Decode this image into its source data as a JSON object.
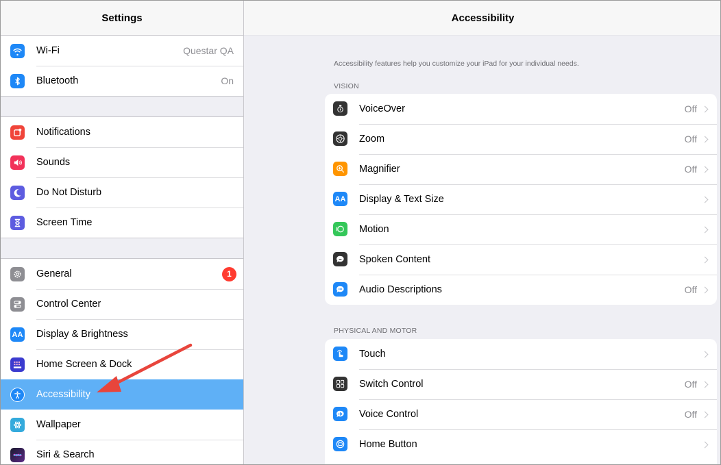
{
  "sidebar": {
    "title": "Settings",
    "groups": [
      [
        {
          "label": "Wi-Fi",
          "value": "Questar QA",
          "icon": "wifi-icon"
        },
        {
          "label": "Bluetooth",
          "value": "On",
          "icon": "bluetooth-icon"
        }
      ],
      [
        {
          "label": "Notifications",
          "icon": "notifications-icon"
        },
        {
          "label": "Sounds",
          "icon": "sounds-icon"
        },
        {
          "label": "Do Not Disturb",
          "icon": "moon-icon"
        },
        {
          "label": "Screen Time",
          "icon": "hourglass-icon"
        }
      ],
      [
        {
          "label": "General",
          "badge": "1",
          "icon": "gear-icon"
        },
        {
          "label": "Control Center",
          "icon": "toggles-icon"
        },
        {
          "label": "Display & Brightness",
          "icon": "display-aa-icon"
        },
        {
          "label": "Home Screen & Dock",
          "icon": "grid-icon"
        },
        {
          "label": "Accessibility",
          "icon": "accessibility-icon",
          "selected": true
        },
        {
          "label": "Wallpaper",
          "icon": "flower-icon"
        },
        {
          "label": "Siri & Search",
          "icon": "siri-icon"
        }
      ]
    ]
  },
  "detail": {
    "title": "Accessibility",
    "description": "Accessibility features help you customize your iPad for your individual needs.",
    "sections": [
      {
        "title": "VISION",
        "items": [
          {
            "label": "VoiceOver",
            "value": "Off"
          },
          {
            "label": "Zoom",
            "value": "Off"
          },
          {
            "label": "Magnifier",
            "value": "Off"
          },
          {
            "label": "Display & Text Size",
            "value": ""
          },
          {
            "label": "Motion",
            "value": ""
          },
          {
            "label": "Spoken Content",
            "value": ""
          },
          {
            "label": "Audio Descriptions",
            "value": "Off"
          }
        ]
      },
      {
        "title": "PHYSICAL AND MOTOR",
        "items": [
          {
            "label": "Touch",
            "value": ""
          },
          {
            "label": "Switch Control",
            "value": "Off"
          },
          {
            "label": "Voice Control",
            "value": "Off"
          },
          {
            "label": "Home Button",
            "value": ""
          }
        ]
      }
    ]
  },
  "colors": {
    "selected_row": "#5fb0f6",
    "annotation_arrow": "#e8453c",
    "badge": "#ff3b30"
  }
}
